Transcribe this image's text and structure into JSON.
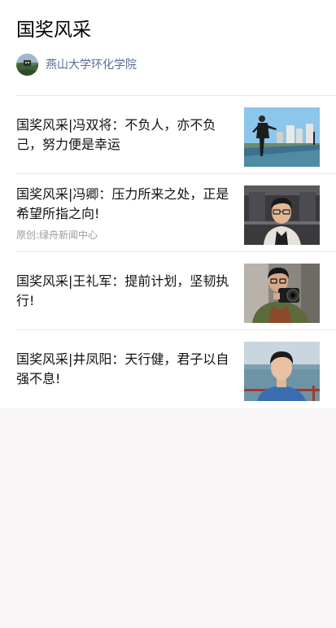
{
  "header": {
    "title": "国奖风采",
    "account_name": "燕山大学环化学院"
  },
  "articles": [
    {
      "title": "国奖风采|冯双将：不负人，亦不负己，努力便是幸运",
      "source": "",
      "thumb_icon": "person-outdoor-pose-image"
    },
    {
      "title": "国奖风采|冯卿：压力所来之处，正是希望所指之向!",
      "source": "原创:绿舟新闻中心",
      "thumb_icon": "portrait-glasses-image"
    },
    {
      "title": "国奖风采|王礼军：提前计划，坚韧执行!",
      "source": "",
      "thumb_icon": "person-with-camera-image"
    },
    {
      "title": "国奖风采|井凤阳：天行健，君子以自强不息!",
      "source": "",
      "thumb_icon": "portrait-seaside-image"
    }
  ],
  "colors": {
    "account_link": "#576b95",
    "divider": "#e8e8e8",
    "page_background": "#f7f5f6"
  }
}
